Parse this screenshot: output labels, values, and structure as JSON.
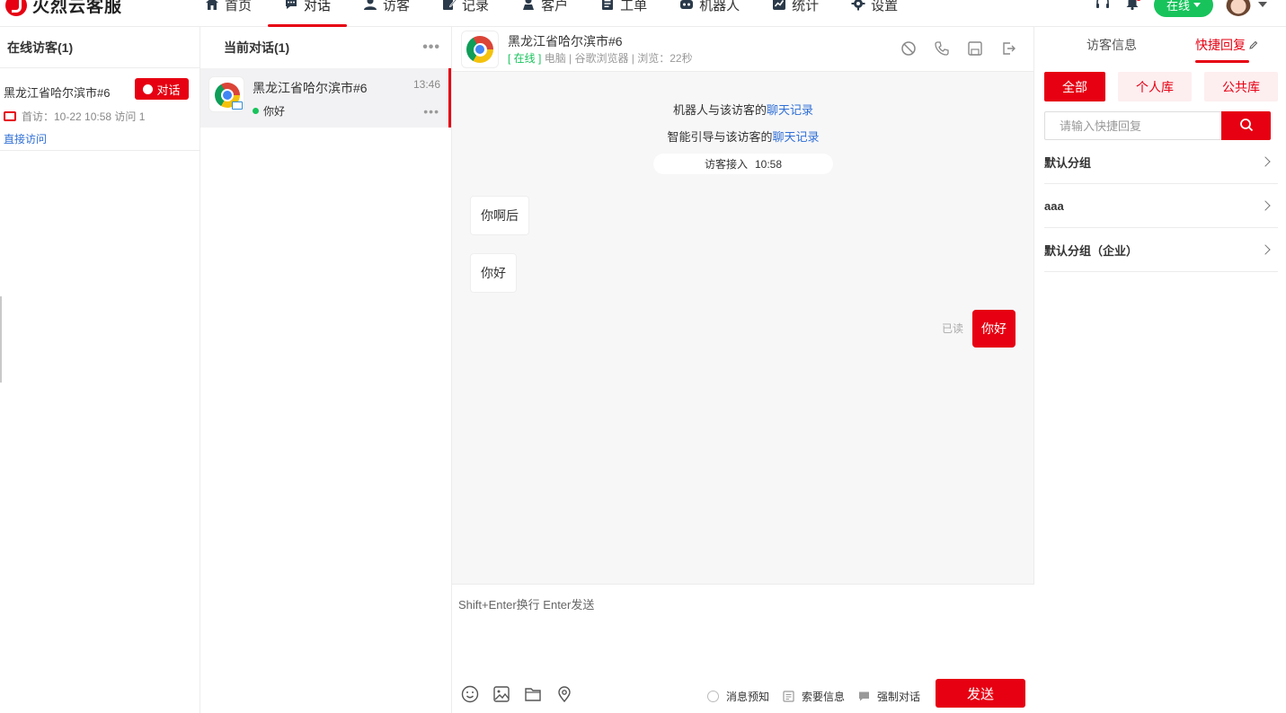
{
  "app": {
    "name": "火烈云客服"
  },
  "nav": [
    {
      "label": "首页",
      "icon": "home-icon"
    },
    {
      "label": "对话",
      "icon": "chat-icon"
    },
    {
      "label": "访客",
      "icon": "user-icon"
    },
    {
      "label": "记录",
      "icon": "edit-icon"
    },
    {
      "label": "客户",
      "icon": "customer-icon"
    },
    {
      "label": "工单",
      "icon": "ticket-icon"
    },
    {
      "label": "机器人",
      "icon": "robot-icon"
    },
    {
      "label": "统计",
      "icon": "chart-icon"
    },
    {
      "label": "设置",
      "icon": "gear-icon"
    }
  ],
  "active_nav": "对话",
  "status": {
    "label": "在线",
    "color": "#18c35c"
  },
  "brand_color": "#e60012",
  "online_visitors": {
    "title": "在线访客(1)",
    "visitor": {
      "name": "黑龙江省哈尔滨市#6",
      "chat_label": "对话",
      "visit_info": "首访：10-22 10:58 访问 1",
      "source": "直接访问"
    }
  },
  "conversations": {
    "title": "当前对话(1)",
    "items": [
      {
        "name": "黑龙江省哈尔滨市#6",
        "time": "13:46",
        "last_message": "你好"
      }
    ]
  },
  "chat": {
    "header": {
      "name": "黑龙江省哈尔滨市#6",
      "status": "[ 在线 ]",
      "meta": "电脑 | 谷歌浏览器 | 浏览：22秒"
    },
    "system_lines": [
      {
        "prefix": "机器人与该访客的",
        "link": "聊天记录"
      },
      {
        "prefix": "智能引导与该访客的",
        "link": "聊天记录"
      }
    ],
    "join": {
      "label": "访客接入",
      "time": "10:58"
    },
    "messages": [
      {
        "from": "visitor",
        "text": "你啊后"
      },
      {
        "from": "visitor",
        "text": "你好"
      },
      {
        "from": "agent",
        "text": "你好",
        "read_label": "已读"
      }
    ],
    "input_placeholder": "Shift+Enter换行 Enter发送",
    "options": {
      "preview": "消息预知",
      "request_info": "索要信息",
      "force_chat": "强制对话"
    },
    "send_label": "发送"
  },
  "right_panel": {
    "tabs": [
      {
        "label": "访客信息"
      },
      {
        "label": "快捷回复"
      }
    ],
    "active_tab": "快捷回复",
    "libraries": [
      {
        "label": "全部"
      },
      {
        "label": "个人库"
      },
      {
        "label": "公共库"
      }
    ],
    "search_placeholder": "请输入快捷回复",
    "groups": [
      {
        "label": "默认分组"
      },
      {
        "label": "aaa"
      },
      {
        "label": "默认分组（企业）"
      }
    ]
  }
}
